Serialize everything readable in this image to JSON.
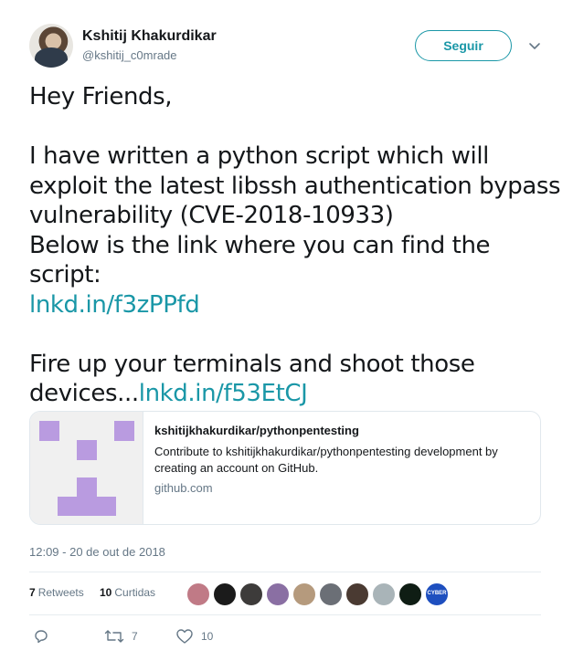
{
  "author": {
    "name": "Kshitij Khakurdikar",
    "handle": "@kshitij_c0mrade",
    "follow_label": "Seguir"
  },
  "tweet": {
    "lines": [
      "Hey Friends,",
      "",
      "I have written a python script which will",
      "exploit the latest libssh authentication bypass",
      "vulnerability (CVE-2018-10933)",
      "Below is the link where you can find the",
      "script:"
    ],
    "link1": "lnkd.in/f3zPPfd",
    "line_fire1": "Fire up your terminals and shoot those",
    "line_fire2_prefix": "devices...",
    "link2": "lnkd.in/f53EtCJ"
  },
  "card": {
    "title": "kshitijkhakurdikar/pythonpentesting",
    "description": "Contribute to kshitijkhakurdikar/pythonpentesting development by creating an account on GitHub.",
    "domain": "github.com"
  },
  "timestamp": "12:09 - 20 de out de 2018",
  "stats": {
    "retweets_count": "7",
    "retweets_label": "Retweets",
    "likes_count": "10",
    "likes_label": "Curtidas"
  },
  "actions": {
    "reply_count": "",
    "retweet_count": "7",
    "like_count": "10"
  },
  "colors": {
    "accent": "#1a97a7",
    "text": "#14171a",
    "muted": "#657786",
    "identicon": "#b99be0"
  },
  "icons": [
    "chevron-down-icon",
    "reply-icon",
    "retweet-icon",
    "like-icon"
  ],
  "liker_badge_text": "CYBER"
}
